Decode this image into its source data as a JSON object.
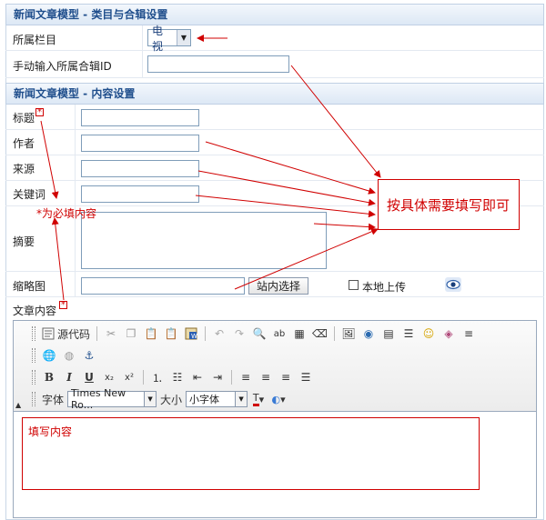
{
  "section1": {
    "title": "新闻文章模型 - 类目与合辑设置",
    "category_label": "所属栏目",
    "category_value": "电视",
    "album_label": "手动输入所属合辑ID",
    "album_value": ""
  },
  "section2": {
    "title": "新闻文章模型 - 内容设置",
    "title_label": "标题",
    "author_label": "作者",
    "source_label": "来源",
    "keywords_label": "关键词",
    "summary_label": "摘要",
    "thumb_label": "缩略图",
    "thumb_button": "站内选择",
    "local_upload_label": "本地上传",
    "content_label": "文章内容",
    "required_mark": "*"
  },
  "annotations": {
    "required_note": "*为必填内容",
    "fill_note": "按具体需要填写即可",
    "content_note": "填写内容",
    "color": "#d00000"
  },
  "editor": {
    "source_code": "源代码",
    "font_label": "字体",
    "font_value": "Times New Ro...",
    "size_label": "大小",
    "size_value": "小字体",
    "bold": "B",
    "italic": "I",
    "underline": "U",
    "subscript": "x₂",
    "superscript": "x²"
  }
}
